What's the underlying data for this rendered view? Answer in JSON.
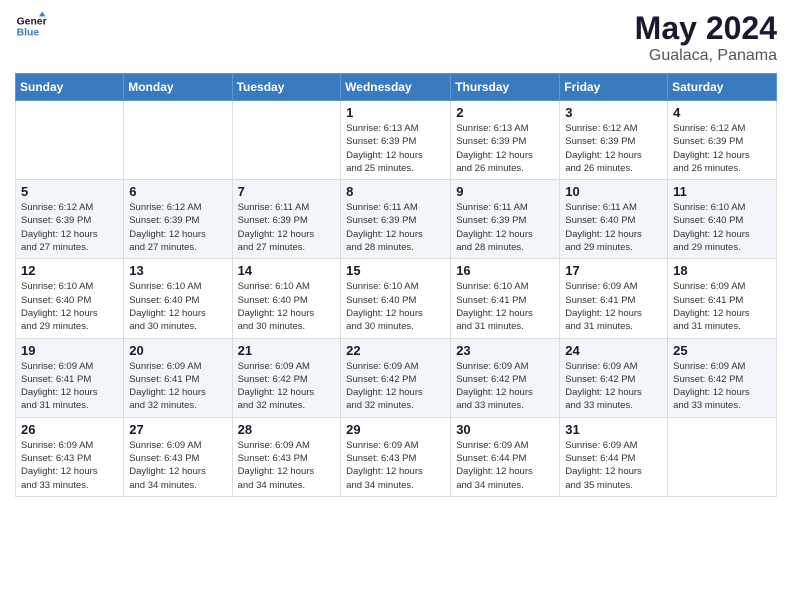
{
  "logo": {
    "line1": "General",
    "line2": "Blue"
  },
  "title": {
    "month_year": "May 2024",
    "location": "Gualaca, Panama"
  },
  "days_of_week": [
    "Sunday",
    "Monday",
    "Tuesday",
    "Wednesday",
    "Thursday",
    "Friday",
    "Saturday"
  ],
  "weeks": [
    [
      {
        "day": "",
        "info": ""
      },
      {
        "day": "",
        "info": ""
      },
      {
        "day": "",
        "info": ""
      },
      {
        "day": "1",
        "sunrise": "6:13 AM",
        "sunset": "6:39 PM",
        "daylight": "12 hours and 25 minutes."
      },
      {
        "day": "2",
        "sunrise": "6:13 AM",
        "sunset": "6:39 PM",
        "daylight": "12 hours and 26 minutes."
      },
      {
        "day": "3",
        "sunrise": "6:12 AM",
        "sunset": "6:39 PM",
        "daylight": "12 hours and 26 minutes."
      },
      {
        "day": "4",
        "sunrise": "6:12 AM",
        "sunset": "6:39 PM",
        "daylight": "12 hours and 26 minutes."
      }
    ],
    [
      {
        "day": "5",
        "sunrise": "6:12 AM",
        "sunset": "6:39 PM",
        "daylight": "12 hours and 27 minutes."
      },
      {
        "day": "6",
        "sunrise": "6:12 AM",
        "sunset": "6:39 PM",
        "daylight": "12 hours and 27 minutes."
      },
      {
        "day": "7",
        "sunrise": "6:11 AM",
        "sunset": "6:39 PM",
        "daylight": "12 hours and 27 minutes."
      },
      {
        "day": "8",
        "sunrise": "6:11 AM",
        "sunset": "6:39 PM",
        "daylight": "12 hours and 28 minutes."
      },
      {
        "day": "9",
        "sunrise": "6:11 AM",
        "sunset": "6:39 PM",
        "daylight": "12 hours and 28 minutes."
      },
      {
        "day": "10",
        "sunrise": "6:11 AM",
        "sunset": "6:40 PM",
        "daylight": "12 hours and 29 minutes."
      },
      {
        "day": "11",
        "sunrise": "6:10 AM",
        "sunset": "6:40 PM",
        "daylight": "12 hours and 29 minutes."
      }
    ],
    [
      {
        "day": "12",
        "sunrise": "6:10 AM",
        "sunset": "6:40 PM",
        "daylight": "12 hours and 29 minutes."
      },
      {
        "day": "13",
        "sunrise": "6:10 AM",
        "sunset": "6:40 PM",
        "daylight": "12 hours and 30 minutes."
      },
      {
        "day": "14",
        "sunrise": "6:10 AM",
        "sunset": "6:40 PM",
        "daylight": "12 hours and 30 minutes."
      },
      {
        "day": "15",
        "sunrise": "6:10 AM",
        "sunset": "6:40 PM",
        "daylight": "12 hours and 30 minutes."
      },
      {
        "day": "16",
        "sunrise": "6:10 AM",
        "sunset": "6:41 PM",
        "daylight": "12 hours and 31 minutes."
      },
      {
        "day": "17",
        "sunrise": "6:09 AM",
        "sunset": "6:41 PM",
        "daylight": "12 hours and 31 minutes."
      },
      {
        "day": "18",
        "sunrise": "6:09 AM",
        "sunset": "6:41 PM",
        "daylight": "12 hours and 31 minutes."
      }
    ],
    [
      {
        "day": "19",
        "sunrise": "6:09 AM",
        "sunset": "6:41 PM",
        "daylight": "12 hours and 31 minutes."
      },
      {
        "day": "20",
        "sunrise": "6:09 AM",
        "sunset": "6:41 PM",
        "daylight": "12 hours and 32 minutes."
      },
      {
        "day": "21",
        "sunrise": "6:09 AM",
        "sunset": "6:42 PM",
        "daylight": "12 hours and 32 minutes."
      },
      {
        "day": "22",
        "sunrise": "6:09 AM",
        "sunset": "6:42 PM",
        "daylight": "12 hours and 32 minutes."
      },
      {
        "day": "23",
        "sunrise": "6:09 AM",
        "sunset": "6:42 PM",
        "daylight": "12 hours and 33 minutes."
      },
      {
        "day": "24",
        "sunrise": "6:09 AM",
        "sunset": "6:42 PM",
        "daylight": "12 hours and 33 minutes."
      },
      {
        "day": "25",
        "sunrise": "6:09 AM",
        "sunset": "6:42 PM",
        "daylight": "12 hours and 33 minutes."
      }
    ],
    [
      {
        "day": "26",
        "sunrise": "6:09 AM",
        "sunset": "6:43 PM",
        "daylight": "12 hours and 33 minutes."
      },
      {
        "day": "27",
        "sunrise": "6:09 AM",
        "sunset": "6:43 PM",
        "daylight": "12 hours and 34 minutes."
      },
      {
        "day": "28",
        "sunrise": "6:09 AM",
        "sunset": "6:43 PM",
        "daylight": "12 hours and 34 minutes."
      },
      {
        "day": "29",
        "sunrise": "6:09 AM",
        "sunset": "6:43 PM",
        "daylight": "12 hours and 34 minutes."
      },
      {
        "day": "30",
        "sunrise": "6:09 AM",
        "sunset": "6:44 PM",
        "daylight": "12 hours and 34 minutes."
      },
      {
        "day": "31",
        "sunrise": "6:09 AM",
        "sunset": "6:44 PM",
        "daylight": "12 hours and 35 minutes."
      },
      {
        "day": "",
        "info": ""
      }
    ]
  ],
  "labels": {
    "sunrise": "Sunrise:",
    "sunset": "Sunset:",
    "daylight": "Daylight:"
  }
}
